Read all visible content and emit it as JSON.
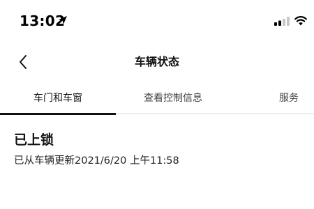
{
  "status_bar": {
    "time": "13:02",
    "icons": [
      "location-arrow-icon",
      "cellular-signal-icon",
      "wifi-icon"
    ]
  },
  "nav": {
    "back_icon": "chevron-left-icon",
    "title": "车辆状态"
  },
  "tabs": [
    {
      "label": "车门和车窗",
      "active": true
    },
    {
      "label": "查看控制信息",
      "active": false
    },
    {
      "label": "服务",
      "active": false
    }
  ],
  "content": {
    "lock_status": "已上锁",
    "update_info": "已从车辆更新2021/6/20 上午11:58"
  },
  "colors": {
    "text": "#111111",
    "tab_indicator": "#111111",
    "signal_inactive": "#c7c7c7"
  }
}
